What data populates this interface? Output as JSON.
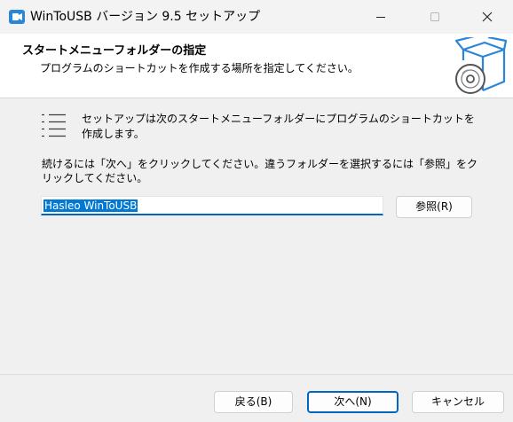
{
  "titlebar": {
    "title": "WinToUSB バージョン 9.5 セットアップ",
    "icons": {
      "app": "wintousb-app-icon",
      "minimize": "minimize-icon",
      "maximize": "maximize-icon",
      "close": "close-icon"
    }
  },
  "header": {
    "title": "スタートメニューフォルダーの指定",
    "subtitle": "プログラムのショートカットを作成する場所を指定してください。",
    "icon": "box-with-disc-icon"
  },
  "body": {
    "description1": "セットアップは次のスタートメニューフォルダーにプログラムのショートカットを作成します。",
    "description2": "続けるには「次へ」をクリックしてください。違うフォルダーを選択するには「参照」をクリックしてください。",
    "folder_value": "Hasleo WinToUSB",
    "browse_label": "参照(R)",
    "list_icon": "list-icon"
  },
  "footer": {
    "back_label": "戻る(B)",
    "next_label": "次へ(N)",
    "cancel_label": "キャンセル"
  },
  "colors": {
    "accent": "#0067c0",
    "selection": "#0078d4",
    "icon_blue": "#2a86d6"
  }
}
